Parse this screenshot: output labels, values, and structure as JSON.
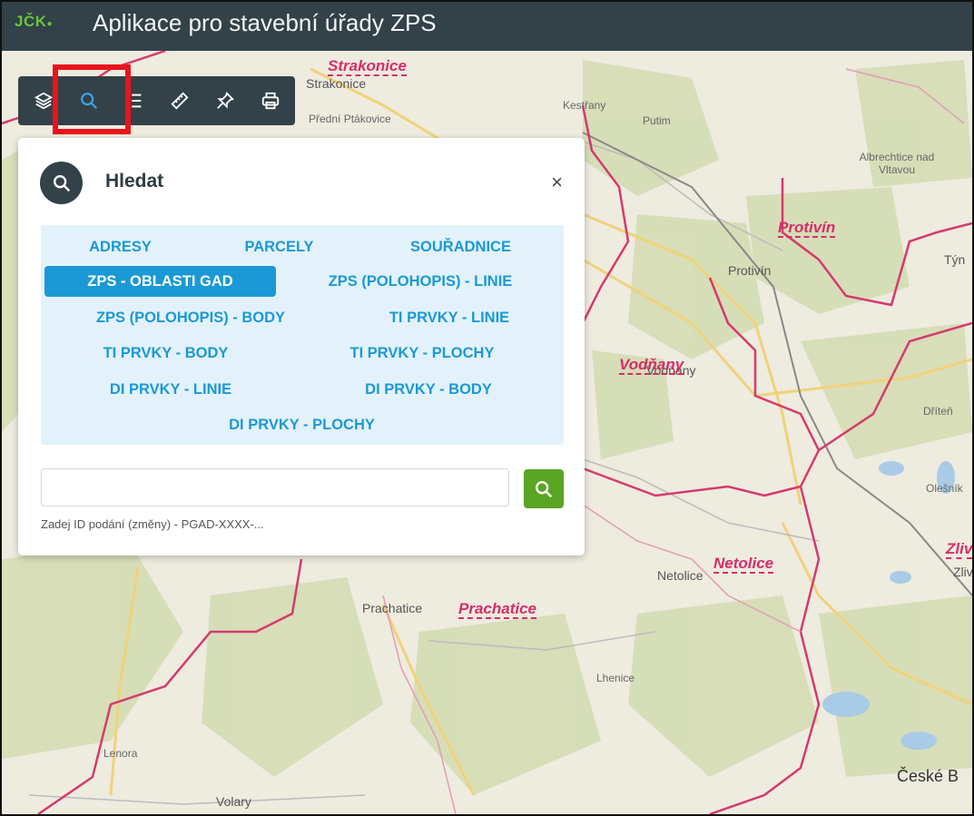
{
  "header": {
    "brand": "JČK",
    "title": "Aplikace pro stavební úřady ZPS"
  },
  "toolbar": {
    "tools": [
      {
        "icon": "layers-icon"
      },
      {
        "icon": "search-icon",
        "active": true
      },
      {
        "icon": "list-icon"
      },
      {
        "icon": "ruler-icon"
      },
      {
        "icon": "pin-icon"
      },
      {
        "icon": "print-icon"
      }
    ]
  },
  "search_panel": {
    "title": "Hledat",
    "close_label": "×",
    "types": [
      {
        "label": "ADRESY"
      },
      {
        "label": "PARCELY"
      },
      {
        "label": "SOUŘADNICE"
      },
      {
        "label": "ZPS - OBLASTI GAD",
        "active": true
      },
      {
        "label": "ZPS (POLOHOPIS) - LINIE"
      },
      {
        "label": "ZPS (POLOHOPIS) - BODY"
      },
      {
        "label": "TI PRVKY - LINIE"
      },
      {
        "label": "TI PRVKY - BODY"
      },
      {
        "label": "TI PRVKY - PLOCHY"
      },
      {
        "label": "DI PRVKY - LINIE"
      },
      {
        "label": "DI PRVKY - BODY"
      },
      {
        "label": "DI PRVKY - PLOCHY"
      }
    ],
    "input_value": "",
    "hint": "Zadej ID podání (změny) - PGAD-XXXX-..."
  },
  "map": {
    "districts": [
      "Strakonice",
      "Protivín",
      "Vodňany",
      "Netolice",
      "Prachatice",
      "Zliv"
    ],
    "places": [
      "Strakonice",
      "Přední Ptákovice",
      "Kestřany",
      "Putim",
      "Albrechtice nad Vltavou",
      "Protivín",
      "Týn",
      "Vodňany",
      "Dříteň",
      "Olešník",
      "Netolice",
      "Zliv",
      "Prachatice",
      "Lhenice",
      "Lenora",
      "Volary",
      "České B"
    ]
  },
  "colors": {
    "header_bg": "#334148",
    "accent": "#1a99d6",
    "search_button": "#5aa524",
    "highlight": "#e8141d",
    "district_label": "#d62d6a"
  }
}
